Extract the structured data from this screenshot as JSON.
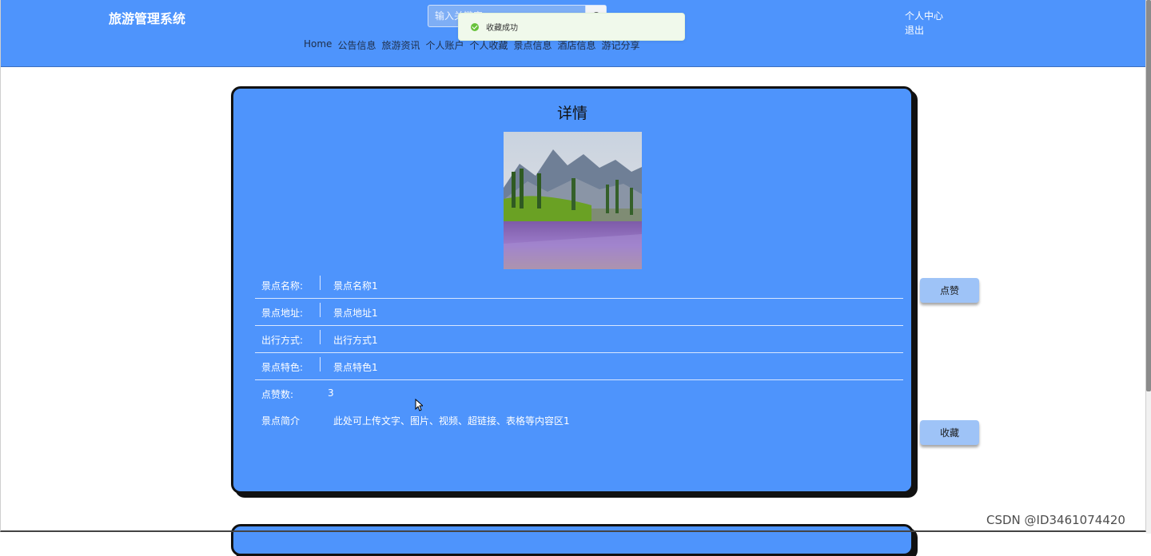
{
  "header": {
    "title": "旅游管理系统",
    "search_placeholder": "输入关键字",
    "user_center": "个人中心",
    "logout": "退出",
    "nav": [
      "Home",
      "公告信息",
      "旅游资讯",
      "个人账户",
      "个人收藏",
      "景点信息",
      "酒店信息",
      "游记分享"
    ]
  },
  "toast": {
    "message": "收藏成功"
  },
  "detail": {
    "title": "详情",
    "rows": [
      {
        "label": "景点名称:",
        "value": "景点名称1"
      },
      {
        "label": "景点地址:",
        "value": "景点地址1"
      },
      {
        "label": "出行方式:",
        "value": "出行方式1"
      },
      {
        "label": "景点特色:",
        "value": "景点特色1"
      }
    ],
    "likes_label": "点赞数:",
    "likes_value": "3",
    "intro_label": "景点简介",
    "intro_value": "此处可上传文字、图片、视频、超链接、表格等内容区1"
  },
  "actions": {
    "like": "点赞",
    "favorite": "收藏"
  },
  "watermark": "CSDN @ID3461074420",
  "colors": {
    "primary": "#4e94fc",
    "button": "#9ec3f7",
    "toast_bg": "#f0f9eb",
    "success": "#67c23a"
  }
}
